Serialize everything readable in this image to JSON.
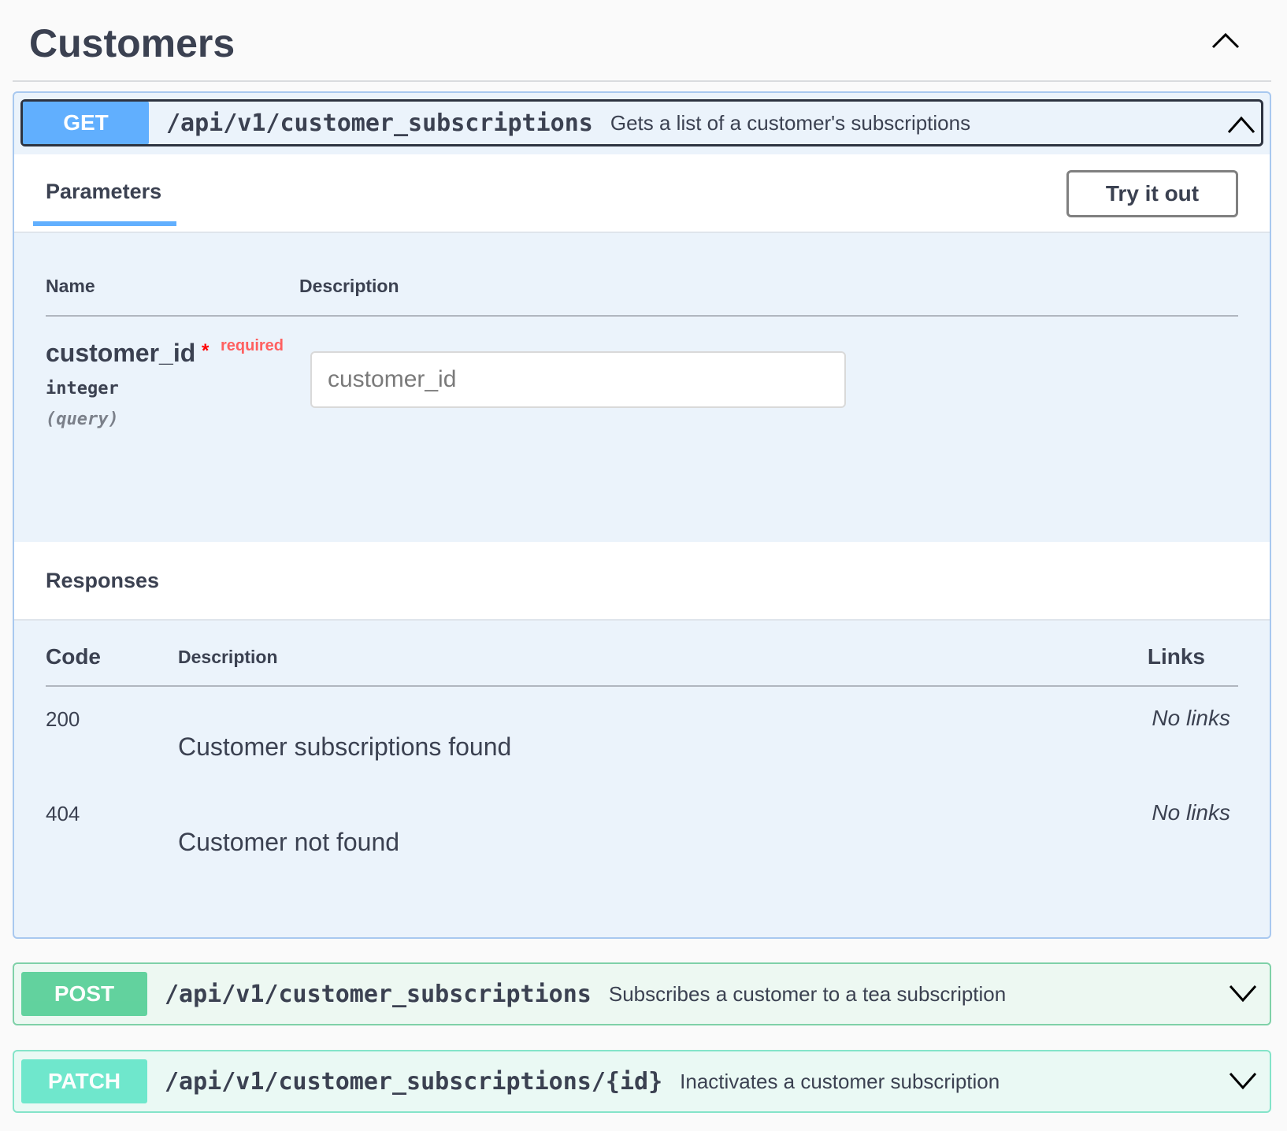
{
  "tag": {
    "title": "Customers"
  },
  "get": {
    "method": "GET",
    "path": "/api/v1/customer_subscriptions",
    "summary": "Gets a list of a customer's subscriptions",
    "parameters_tab": "Parameters",
    "try_button": "Try it out",
    "param_columns": {
      "name": "Name",
      "description": "Description"
    },
    "parameter": {
      "name": "customer_id",
      "required_star": "*",
      "required_label": "required",
      "type": "integer",
      "in": "(query)",
      "placeholder": "customer_id",
      "value": ""
    },
    "responses_title": "Responses",
    "response_columns": {
      "code": "Code",
      "description": "Description",
      "links": "Links"
    },
    "responses": [
      {
        "code": "200",
        "description": "Customer subscriptions found",
        "links": "No links"
      },
      {
        "code": "404",
        "description": "Customer not found",
        "links": "No links"
      }
    ]
  },
  "post": {
    "method": "POST",
    "path": "/api/v1/customer_subscriptions",
    "summary": "Subscribes a customer to a tea subscription"
  },
  "patch": {
    "method": "PATCH",
    "path": "/api/v1/customer_subscriptions/{id}",
    "summary": "Inactivates a customer subscription"
  },
  "colors": {
    "get": "#61affe",
    "post": "#49cc90",
    "patch": "#50e3c2",
    "required": "#ff0000"
  },
  "icons": {
    "collapse": "chevron-up-icon",
    "expand": "chevron-down-icon"
  }
}
